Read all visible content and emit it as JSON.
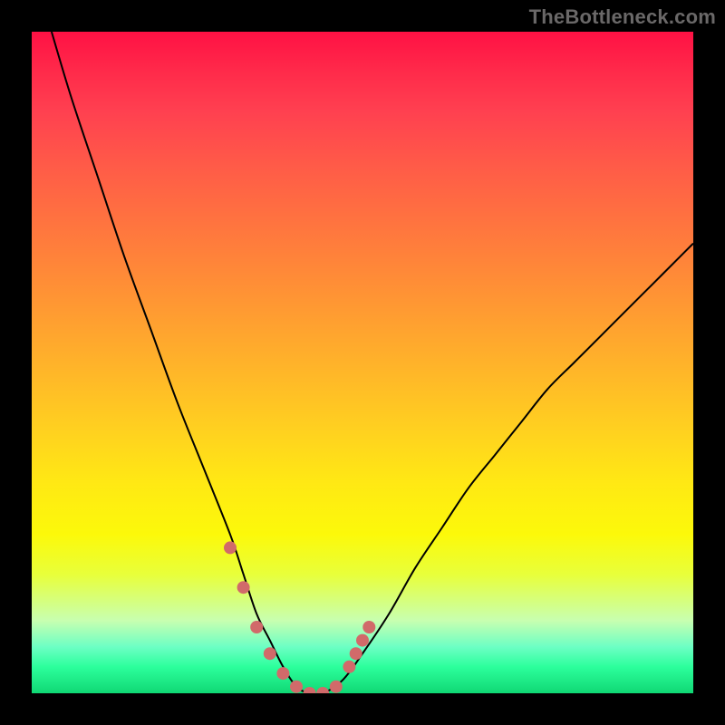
{
  "watermark": "TheBottleneck.com",
  "colors": {
    "frame": "#000000",
    "curve": "#000000",
    "marker": "#d16a6a"
  },
  "chart_data": {
    "type": "line",
    "title": "",
    "xlabel": "",
    "ylabel": "",
    "xlim": [
      0,
      100
    ],
    "ylim": [
      0,
      100
    ],
    "grid": false,
    "series": [
      {
        "name": "bottleneck-curve",
        "x": [
          3,
          6,
          10,
          14,
          18,
          22,
          26,
          30,
          32,
          34,
          36,
          38,
          40,
          42,
          44,
          47,
          50,
          54,
          58,
          62,
          66,
          70,
          74,
          78,
          82,
          86,
          90,
          94,
          98,
          100
        ],
        "y": [
          100,
          90,
          78,
          66,
          55,
          44,
          34,
          24,
          18,
          12,
          8,
          4,
          1,
          0,
          0,
          2,
          6,
          12,
          19,
          25,
          31,
          36,
          41,
          46,
          50,
          54,
          58,
          62,
          66,
          68
        ]
      }
    ],
    "markers": {
      "name": "highlight-points",
      "x": [
        30,
        32,
        34,
        36,
        38,
        40,
        42,
        44,
        46,
        48,
        49,
        50,
        51
      ],
      "y": [
        22,
        16,
        10,
        6,
        3,
        1,
        0,
        0,
        1,
        4,
        6,
        8,
        10
      ]
    }
  }
}
